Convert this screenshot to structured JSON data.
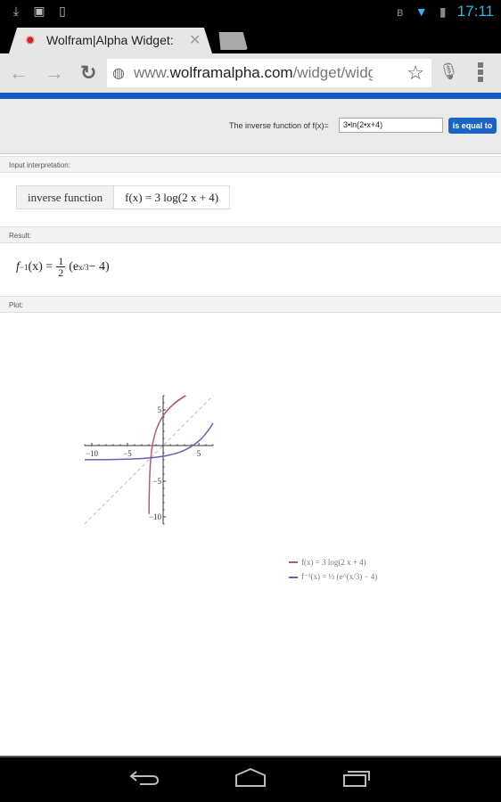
{
  "status_bar": {
    "left_icons": [
      "download-icon",
      "image-icon",
      "sd-card-icon"
    ],
    "right_icons": [
      "bluetooth-icon",
      "wifi-icon",
      "battery-charging-icon"
    ],
    "time": "17:11"
  },
  "browser": {
    "tab": {
      "title": "Wolfram|Alpha Widget:",
      "favicon": "wolfram-star-icon"
    },
    "url_prefix": "www.",
    "url_domain": "wolframalpha.com",
    "url_path": "/widget/widge",
    "icons": [
      "back-icon",
      "forward-icon",
      "reload-icon",
      "globe-icon",
      "star-icon",
      "mic-icon",
      "menu-icon"
    ]
  },
  "widget": {
    "query_label": "The inverse function of f(x)=",
    "query_value": "3•ln(2•x+4)",
    "submit_label": "is equal to",
    "accent": "#1b63c5"
  },
  "pods": {
    "input_title": "Input interpretation:",
    "input_cells": [
      "inverse function",
      "f(x) = 3 log(2 x + 4)"
    ],
    "result_title": "Result:",
    "result_lhs": "f",
    "result_sup": "−1",
    "result_arg": "(x) =",
    "result_num": "1",
    "result_den": "2",
    "result_paren": "(e",
    "result_exp": "x/3",
    "result_tail": " − 4)",
    "plot_title": "Plot:"
  },
  "chart_data": {
    "type": "line",
    "title": "",
    "xlabel": "",
    "ylabel": "",
    "xlim": [
      -11,
      7
    ],
    "ylim": [
      -11,
      7
    ],
    "x_ticks": [
      "−10",
      "−5",
      "5"
    ],
    "y_ticks": [
      "5",
      "−5",
      "−10"
    ],
    "grid": false,
    "series": [
      {
        "name": "f(x) = 3 log(2 x + 4)",
        "color": "#b05a80",
        "formula": "3*ln(2x+4)",
        "domain": [
          -2,
          3
        ]
      },
      {
        "name": "f⁻¹(x) = ½ (e^(x/3) − 4)",
        "color": "#6a62b0",
        "formula": "0.5*(exp(x/3)-4)",
        "domain": [
          -11,
          7
        ]
      },
      {
        "name": "y = x",
        "color": "#bbbbbb",
        "style": "dashed",
        "domain": [
          -11,
          7
        ]
      }
    ],
    "legend": [
      "f(x) = 3 log(2 x + 4)",
      "f⁻¹(x) = ½ (e^(x/3) − 4)"
    ],
    "legend_position": "bottom-right"
  },
  "nav_bar": {
    "icons": [
      "back-nav-icon",
      "home-nav-icon",
      "recent-apps-icon"
    ]
  }
}
